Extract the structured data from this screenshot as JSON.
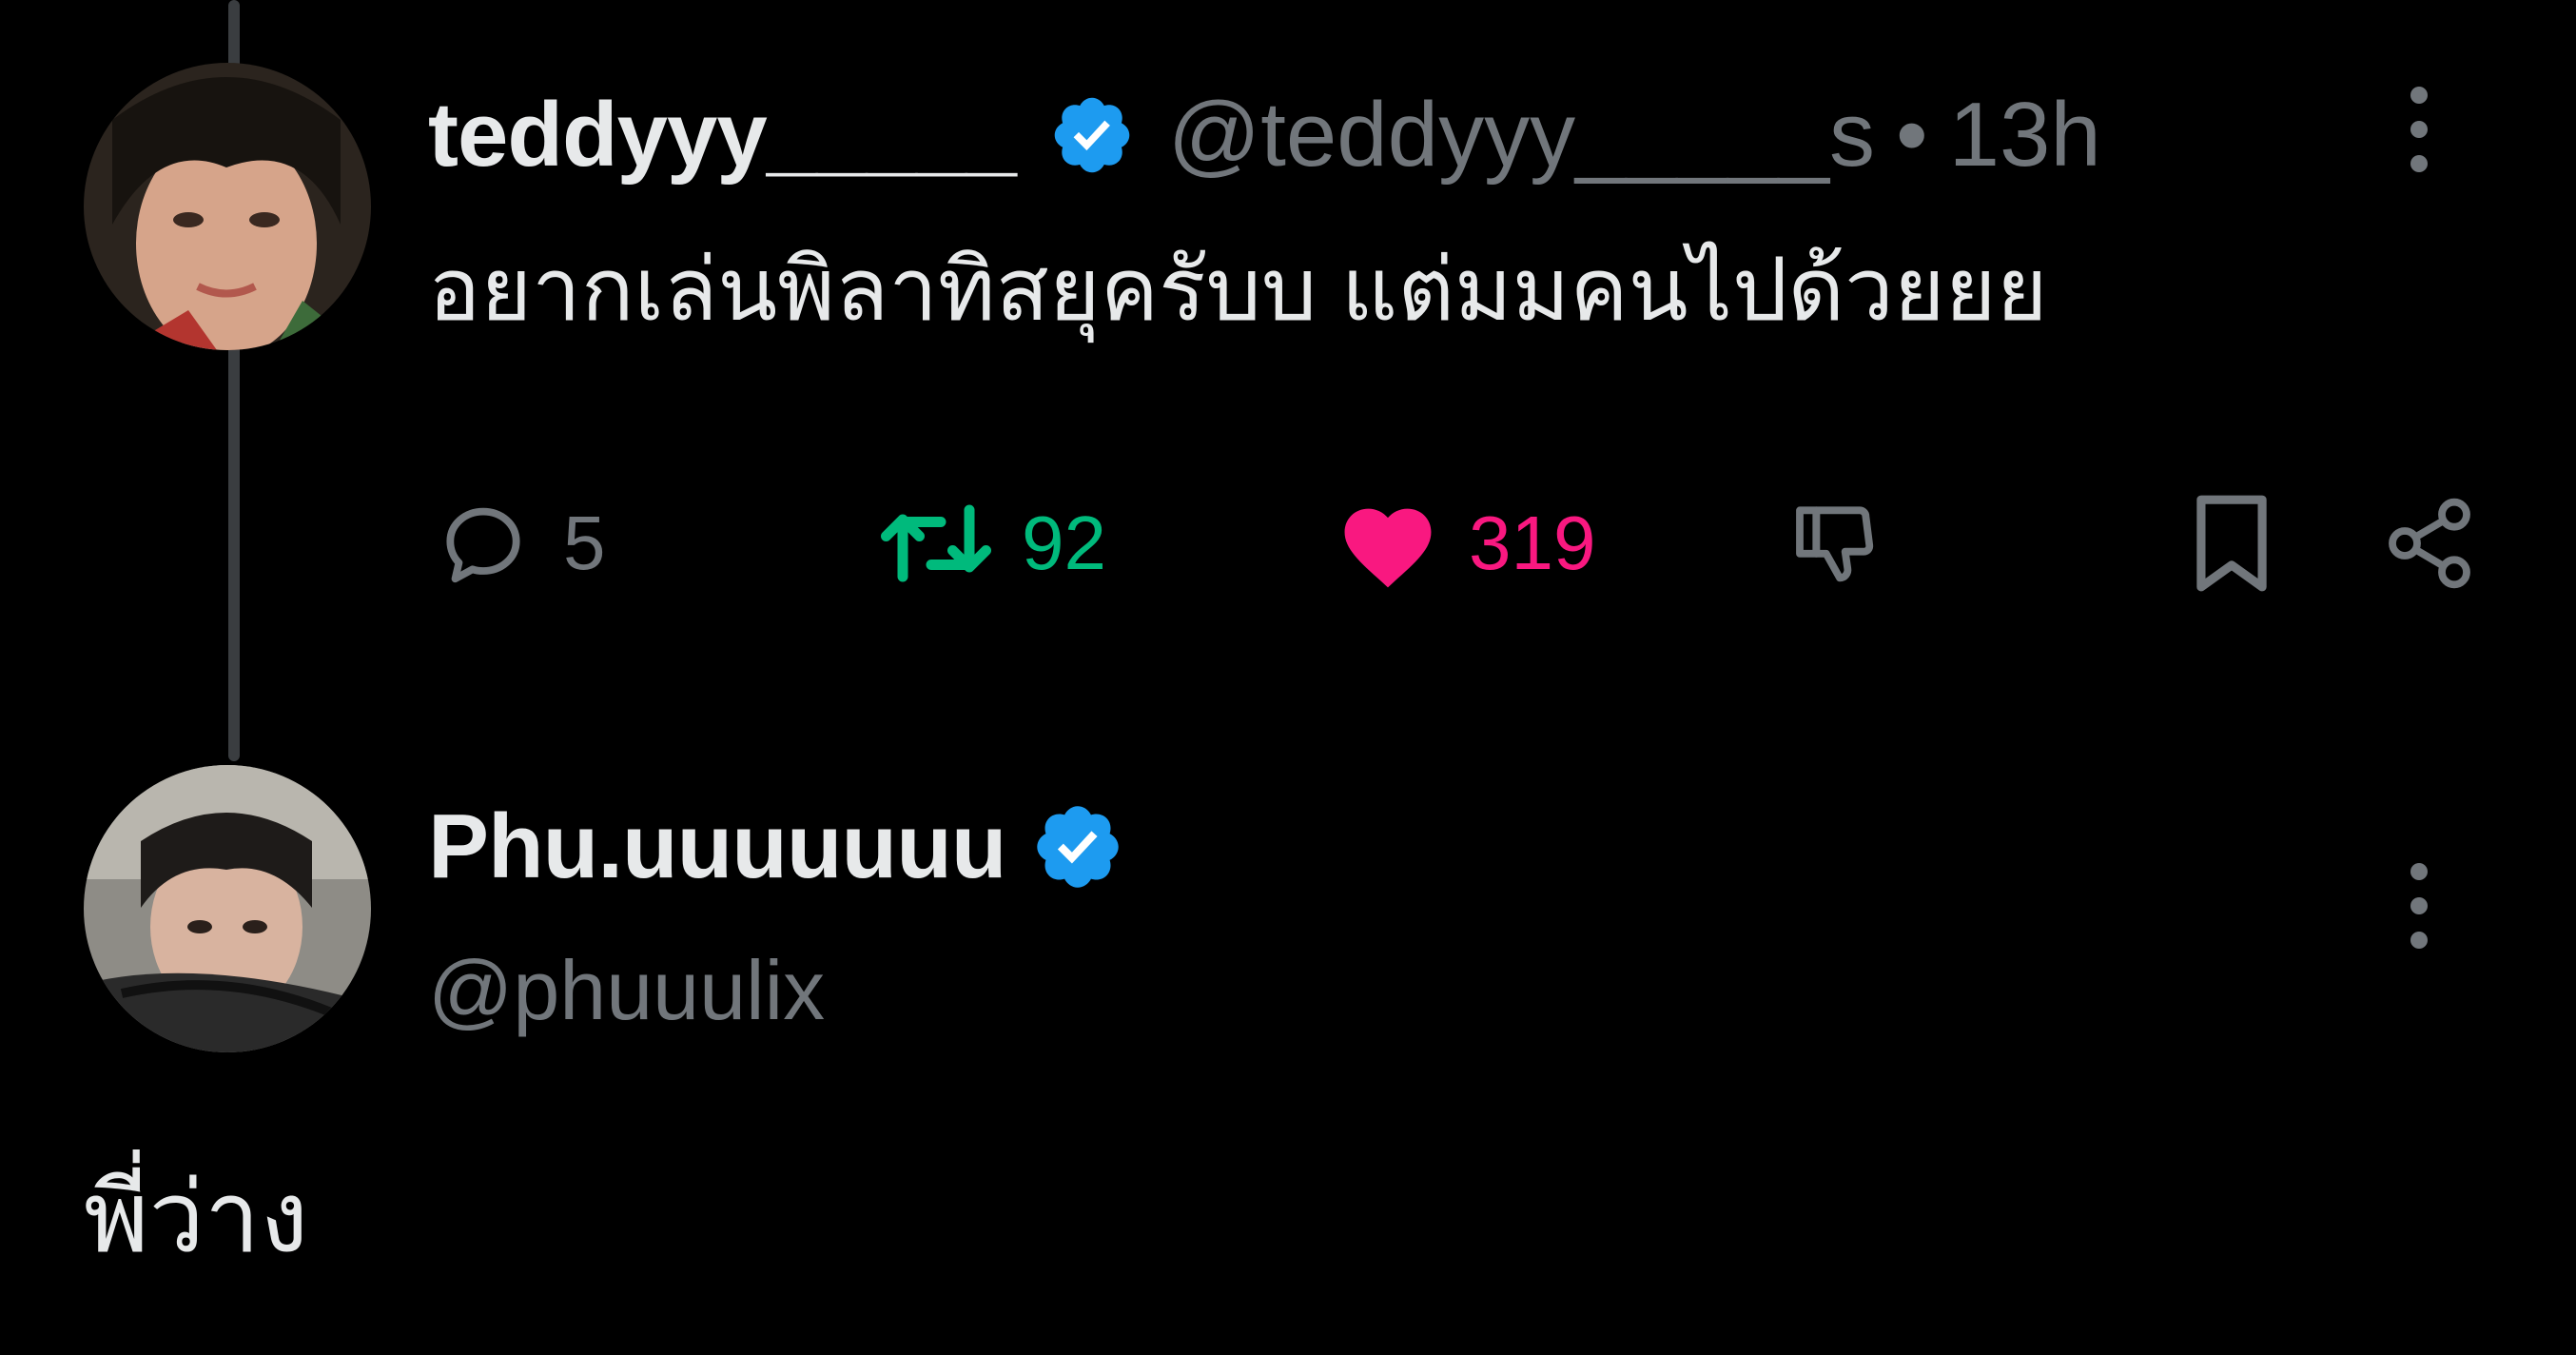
{
  "colors": {
    "background": "#000000",
    "text_primary": "#e7e9ea",
    "text_secondary": "#71767b",
    "verified_badge": "#1d9bf0",
    "retweet_active": "#00ba7c",
    "like_active": "#f91880",
    "thread_line": "#3a3d40"
  },
  "tweet": {
    "author": {
      "display_name": "teddyyy_____",
      "handle": "@teddyyy_____s",
      "verified": true,
      "avatar_icon": "profile-photo"
    },
    "separator": "•",
    "time": "13h",
    "text": "อยากเล่นพิลาทิสยุครับบ แต่มมคนไปด้วยยย",
    "more_icon": "vertical-ellipsis-icon",
    "actions": {
      "replies": {
        "icon": "reply-bubble-icon",
        "count": "5",
        "color": "#71767b"
      },
      "retweets": {
        "icon": "retweet-icon",
        "count": "92",
        "active": true,
        "color": "#00ba7c"
      },
      "likes": {
        "icon": "heart-icon",
        "count": "319",
        "active": true,
        "color": "#f91880"
      },
      "dislike": {
        "icon": "thumbs-down-icon"
      },
      "bookmark": {
        "icon": "bookmark-icon"
      },
      "share": {
        "icon": "share-icon"
      }
    }
  },
  "reply": {
    "author": {
      "display_name": "Phu.uuuuuuu",
      "handle": "@phuuulix",
      "verified": true,
      "avatar_icon": "profile-photo"
    },
    "more_icon": "vertical-ellipsis-icon",
    "text": "พี่ว่าง"
  }
}
